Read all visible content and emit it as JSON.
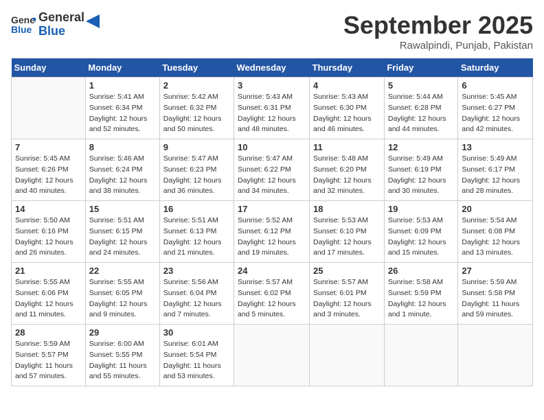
{
  "header": {
    "logo_line1": "General",
    "logo_line2": "Blue",
    "month_title": "September 2025",
    "subtitle": "Rawalpindi, Punjab, Pakistan"
  },
  "weekdays": [
    "Sunday",
    "Monday",
    "Tuesday",
    "Wednesday",
    "Thursday",
    "Friday",
    "Saturday"
  ],
  "weeks": [
    [
      {
        "day": "",
        "sunrise": "",
        "sunset": "",
        "daylight": ""
      },
      {
        "day": "1",
        "sunrise": "Sunrise: 5:41 AM",
        "sunset": "Sunset: 6:34 PM",
        "daylight": "Daylight: 12 hours and 52 minutes."
      },
      {
        "day": "2",
        "sunrise": "Sunrise: 5:42 AM",
        "sunset": "Sunset: 6:32 PM",
        "daylight": "Daylight: 12 hours and 50 minutes."
      },
      {
        "day": "3",
        "sunrise": "Sunrise: 5:43 AM",
        "sunset": "Sunset: 6:31 PM",
        "daylight": "Daylight: 12 hours and 48 minutes."
      },
      {
        "day": "4",
        "sunrise": "Sunrise: 5:43 AM",
        "sunset": "Sunset: 6:30 PM",
        "daylight": "Daylight: 12 hours and 46 minutes."
      },
      {
        "day": "5",
        "sunrise": "Sunrise: 5:44 AM",
        "sunset": "Sunset: 6:28 PM",
        "daylight": "Daylight: 12 hours and 44 minutes."
      },
      {
        "day": "6",
        "sunrise": "Sunrise: 5:45 AM",
        "sunset": "Sunset: 6:27 PM",
        "daylight": "Daylight: 12 hours and 42 minutes."
      }
    ],
    [
      {
        "day": "7",
        "sunrise": "Sunrise: 5:45 AM",
        "sunset": "Sunset: 6:26 PM",
        "daylight": "Daylight: 12 hours and 40 minutes."
      },
      {
        "day": "8",
        "sunrise": "Sunrise: 5:46 AM",
        "sunset": "Sunset: 6:24 PM",
        "daylight": "Daylight: 12 hours and 38 minutes."
      },
      {
        "day": "9",
        "sunrise": "Sunrise: 5:47 AM",
        "sunset": "Sunset: 6:23 PM",
        "daylight": "Daylight: 12 hours and 36 minutes."
      },
      {
        "day": "10",
        "sunrise": "Sunrise: 5:47 AM",
        "sunset": "Sunset: 6:22 PM",
        "daylight": "Daylight: 12 hours and 34 minutes."
      },
      {
        "day": "11",
        "sunrise": "Sunrise: 5:48 AM",
        "sunset": "Sunset: 6:20 PM",
        "daylight": "Daylight: 12 hours and 32 minutes."
      },
      {
        "day": "12",
        "sunrise": "Sunrise: 5:49 AM",
        "sunset": "Sunset: 6:19 PM",
        "daylight": "Daylight: 12 hours and 30 minutes."
      },
      {
        "day": "13",
        "sunrise": "Sunrise: 5:49 AM",
        "sunset": "Sunset: 6:17 PM",
        "daylight": "Daylight: 12 hours and 28 minutes."
      }
    ],
    [
      {
        "day": "14",
        "sunrise": "Sunrise: 5:50 AM",
        "sunset": "Sunset: 6:16 PM",
        "daylight": "Daylight: 12 hours and 26 minutes."
      },
      {
        "day": "15",
        "sunrise": "Sunrise: 5:51 AM",
        "sunset": "Sunset: 6:15 PM",
        "daylight": "Daylight: 12 hours and 24 minutes."
      },
      {
        "day": "16",
        "sunrise": "Sunrise: 5:51 AM",
        "sunset": "Sunset: 6:13 PM",
        "daylight": "Daylight: 12 hours and 21 minutes."
      },
      {
        "day": "17",
        "sunrise": "Sunrise: 5:52 AM",
        "sunset": "Sunset: 6:12 PM",
        "daylight": "Daylight: 12 hours and 19 minutes."
      },
      {
        "day": "18",
        "sunrise": "Sunrise: 5:53 AM",
        "sunset": "Sunset: 6:10 PM",
        "daylight": "Daylight: 12 hours and 17 minutes."
      },
      {
        "day": "19",
        "sunrise": "Sunrise: 5:53 AM",
        "sunset": "Sunset: 6:09 PM",
        "daylight": "Daylight: 12 hours and 15 minutes."
      },
      {
        "day": "20",
        "sunrise": "Sunrise: 5:54 AM",
        "sunset": "Sunset: 6:08 PM",
        "daylight": "Daylight: 12 hours and 13 minutes."
      }
    ],
    [
      {
        "day": "21",
        "sunrise": "Sunrise: 5:55 AM",
        "sunset": "Sunset: 6:06 PM",
        "daylight": "Daylight: 12 hours and 11 minutes."
      },
      {
        "day": "22",
        "sunrise": "Sunrise: 5:55 AM",
        "sunset": "Sunset: 6:05 PM",
        "daylight": "Daylight: 12 hours and 9 minutes."
      },
      {
        "day": "23",
        "sunrise": "Sunrise: 5:56 AM",
        "sunset": "Sunset: 6:04 PM",
        "daylight": "Daylight: 12 hours and 7 minutes."
      },
      {
        "day": "24",
        "sunrise": "Sunrise: 5:57 AM",
        "sunset": "Sunset: 6:02 PM",
        "daylight": "Daylight: 12 hours and 5 minutes."
      },
      {
        "day": "25",
        "sunrise": "Sunrise: 5:57 AM",
        "sunset": "Sunset: 6:01 PM",
        "daylight": "Daylight: 12 hours and 3 minutes."
      },
      {
        "day": "26",
        "sunrise": "Sunrise: 5:58 AM",
        "sunset": "Sunset: 5:59 PM",
        "daylight": "Daylight: 12 hours and 1 minute."
      },
      {
        "day": "27",
        "sunrise": "Sunrise: 5:59 AM",
        "sunset": "Sunset: 5:58 PM",
        "daylight": "Daylight: 11 hours and 59 minutes."
      }
    ],
    [
      {
        "day": "28",
        "sunrise": "Sunrise: 5:59 AM",
        "sunset": "Sunset: 5:57 PM",
        "daylight": "Daylight: 11 hours and 57 minutes."
      },
      {
        "day": "29",
        "sunrise": "Sunrise: 6:00 AM",
        "sunset": "Sunset: 5:55 PM",
        "daylight": "Daylight: 11 hours and 55 minutes."
      },
      {
        "day": "30",
        "sunrise": "Sunrise: 6:01 AM",
        "sunset": "Sunset: 5:54 PM",
        "daylight": "Daylight: 11 hours and 53 minutes."
      },
      {
        "day": "",
        "sunrise": "",
        "sunset": "",
        "daylight": ""
      },
      {
        "day": "",
        "sunrise": "",
        "sunset": "",
        "daylight": ""
      },
      {
        "day": "",
        "sunrise": "",
        "sunset": "",
        "daylight": ""
      },
      {
        "day": "",
        "sunrise": "",
        "sunset": "",
        "daylight": ""
      }
    ]
  ]
}
